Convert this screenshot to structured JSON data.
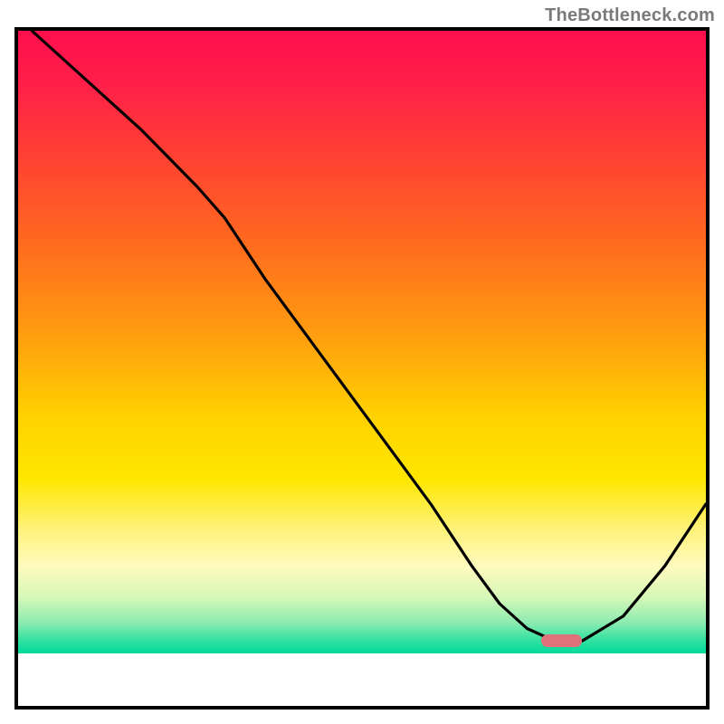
{
  "watermark": {
    "text": "TheBottleneck.com"
  },
  "colors": {
    "gradient_top": "#ff0f4c",
    "gradient_bottom": "#00d99c",
    "border": "#000000",
    "curve": "#000000",
    "marker": "#e0707a",
    "background": "#ffffff"
  },
  "chart_data": {
    "type": "line",
    "title": "",
    "xlabel": "",
    "ylabel": "",
    "xlim": [
      0,
      100
    ],
    "ylim": [
      0,
      100
    ],
    "grid": false,
    "legend": false,
    "series": [
      {
        "name": "bottleneck-curve",
        "x": [
          2,
          10,
          18,
          26,
          30,
          36,
          44,
          52,
          60,
          66,
          70,
          74,
          78,
          82,
          88,
          94,
          100
        ],
        "y": [
          100,
          92,
          84,
          75,
          70,
          60,
          48,
          36,
          24,
          14,
          8,
          4,
          2,
          2,
          6,
          14,
          24
        ]
      }
    ],
    "marker": {
      "x": 79,
      "y": 2,
      "width_pct": 6
    },
    "color_scale": {
      "axis": "y",
      "stops": [
        {
          "y": 100,
          "color": "#ff0f4c"
        },
        {
          "y": 50,
          "color": "#ffd200"
        },
        {
          "y": 10,
          "color": "#fffbbe"
        },
        {
          "y": 2,
          "color": "#00d99c"
        }
      ]
    }
  }
}
